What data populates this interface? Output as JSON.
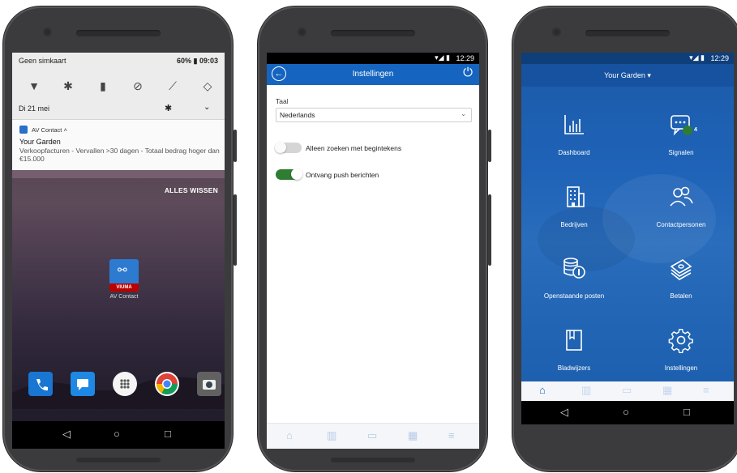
{
  "phone1": {
    "status": {
      "carrier": "Geen simkaart",
      "battery_time": "60% ▮ 09:03"
    },
    "date": "Di 21 mei",
    "notification": {
      "app": "AV Contact ˄",
      "title": "Your Garden",
      "body": "Verkoopfacturen - Vervallen >30 dagen - Totaal bedrag hoger dan €15.000"
    },
    "clear_all": "ALLES WISSEN",
    "app_icon_label": "AV Contact",
    "app_icon_strip": "VIUMA"
  },
  "phone2": {
    "status_time": "12:29",
    "title": "Instellingen",
    "language_label": "Taal",
    "language_value": "Nederlands",
    "toggle1": {
      "label": "Alleen zoeken met begintekens",
      "on": false
    },
    "toggle2": {
      "label": "Ontvang push berichten",
      "on": true
    },
    "colors": {
      "primary": "#1565c0",
      "toggle_on": "#2e7d32"
    }
  },
  "phone3": {
    "status_time": "12:29",
    "title": "Your Garden ▾",
    "tiles": [
      {
        "label": "Dashboard",
        "icon": "bar-chart-icon"
      },
      {
        "label": "Signalen",
        "icon": "chat-badge-icon",
        "badge": "4"
      },
      {
        "label": "Bedrijven",
        "icon": "building-icon"
      },
      {
        "label": "Contactpersonen",
        "icon": "people-icon"
      },
      {
        "label": "Openstaande posten",
        "icon": "coins-icon"
      },
      {
        "label": "Betalen",
        "icon": "money-stack-icon"
      },
      {
        "label": "Bladwijzers",
        "icon": "bookmark-icon"
      },
      {
        "label": "Instellingen",
        "icon": "gear-icon"
      }
    ],
    "colors": {
      "background": "#1f63b8",
      "badge": "#2e7d32"
    }
  }
}
